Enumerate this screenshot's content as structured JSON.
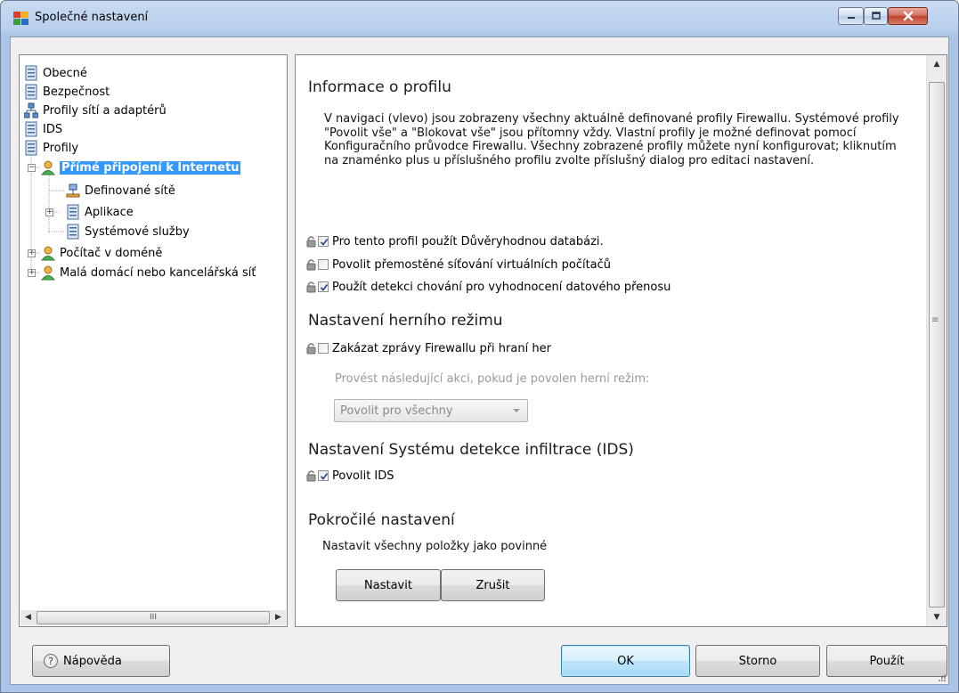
{
  "window": {
    "title": "Společné nastavení"
  },
  "tree": {
    "items": [
      {
        "label": "Obecné",
        "icon": "document-icon"
      },
      {
        "label": "Bezpečnost",
        "icon": "document-icon"
      },
      {
        "label": "Profily sítí a adaptérů",
        "icon": "network-icon"
      },
      {
        "label": "IDS",
        "icon": "document-icon"
      },
      {
        "label": "Profily",
        "icon": "document-icon"
      },
      {
        "label": "Přímé připojení k Internetu",
        "icon": "user-icon",
        "selected": true
      },
      {
        "label": "Definované sítě",
        "icon": "network-icon"
      },
      {
        "label": "Aplikace",
        "icon": "document-icon"
      },
      {
        "label": "Systémové služby",
        "icon": "document-icon"
      },
      {
        "label": "Počítač v doméně",
        "icon": "user-icon"
      },
      {
        "label": "Malá domácí nebo kancelářská síť",
        "icon": "user-icon"
      }
    ],
    "scroll_grip": "III"
  },
  "panel": {
    "title": "Informace o profilu",
    "description": "V navigaci (vlevo) jsou zobrazeny všechny aktuálně definované profily Firewallu. Systémové profily \"Povolit vše\" a \"Blokovat vše\" jsou přítomny vždy. Vlastní profily je možné definovat pomocí Konfiguračního průvodce Firewallu. Všechny zobrazené profily můžete nyní konfigurovat; kliknutím na znaménko plus u příslušného profilu zvolte příslušný dialog pro editaci nastavení.",
    "options": [
      {
        "label": "Pro tento profil použít Důvěryhodnou databázi.",
        "checked": true
      },
      {
        "label": "Povolit přemostěné síťování virtuálních počítačů",
        "checked": false
      },
      {
        "label": "Použít detekci chování pro vyhodnocení datového přenosu",
        "checked": true
      }
    ],
    "game_section": {
      "title": "Nastavení herního režimu",
      "option": {
        "label": "Zakázat zprávy Firewallu při hraní her",
        "checked": false
      },
      "action_label": "Provést následující akci, pokud je povolen herní režim:",
      "action_value": "Povolit pro všechny"
    },
    "ids_section": {
      "title": "Nastavení Systému detekce infiltrace (IDS)",
      "option": {
        "label": "Povolit IDS",
        "checked": true
      }
    },
    "advanced_section": {
      "title": "Pokročilé nastavení",
      "text": "Nastavit všechny položky jako povinné",
      "set_label": "Nastavit",
      "cancel_label": "Zrušit"
    }
  },
  "footer": {
    "help_label": "Nápověda",
    "ok_label": "OK",
    "cancel_label": "Storno",
    "apply_label": "Použít"
  },
  "colors": {
    "selection": "#3399ff",
    "title_bar": "#b9d1ee",
    "close_button": "#c1402e"
  }
}
